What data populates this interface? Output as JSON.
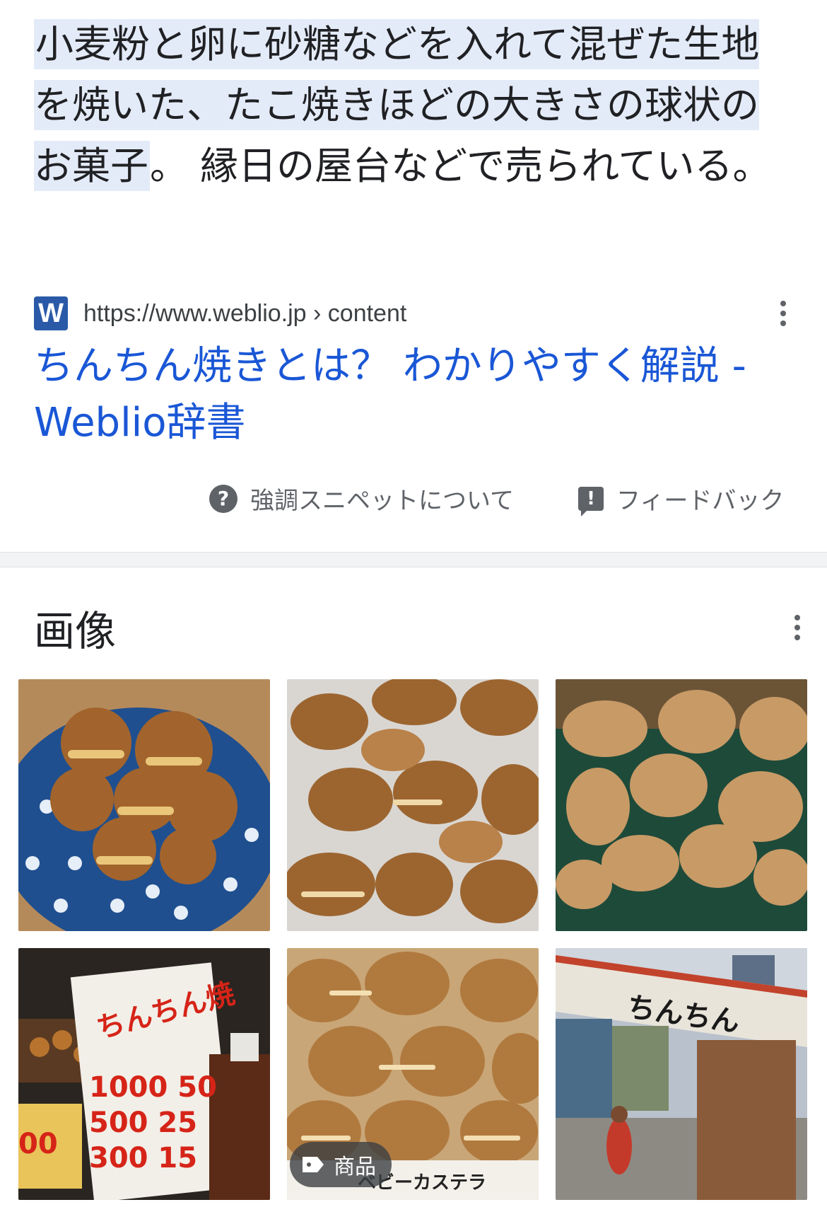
{
  "snippet": {
    "highlighted": "小麦粉と卵に砂糖などを入れて混ぜた生地を焼いた、たこ焼きほどの大きさの球状のお菓子",
    "rest": "。 縁日の屋台などで売られている。"
  },
  "source": {
    "favicon_letter": "W",
    "url": "https://www.weblio.jp › content"
  },
  "result": {
    "title": "ちんちん焼きとは？ わかりやすく解説 - Weblio辞書"
  },
  "footer": {
    "about_label": "強調スニペットについて",
    "feedback_label": "フィードバック"
  },
  "images": {
    "title": "画像",
    "tag_label": "商品",
    "thumb_texts": {
      "sign_title": "ちんちん焼",
      "prices": [
        "1000 50",
        "500 25",
        "300 15"
      ],
      "price_side": "00",
      "packaging": "ベビーカステラ",
      "banner": "ちんちん"
    }
  },
  "colors": {
    "link_blue": "#1a57d6",
    "highlight_bg": "#e4ebf8",
    "favicon_bg": "#2a5aa7"
  }
}
